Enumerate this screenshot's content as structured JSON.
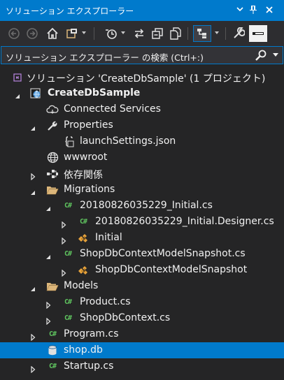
{
  "window": {
    "title": "ソリューション エクスプローラー",
    "buttons": [
      "chevron-down-icon",
      "pin-icon",
      "close-icon"
    ]
  },
  "toolbar": {
    "icons": [
      "back-icon",
      "forward-icon",
      "home-icon",
      "switch-views-icon",
      "pending-changes-filter-icon",
      "sync-icon",
      "collapse-all-icon",
      "show-all-files-icon",
      "properties-icon",
      "preview-icon"
    ]
  },
  "search": {
    "placeholder": "ソリューション エクスプローラー の検索 (Ctrl+:)"
  },
  "tree": [
    {
      "label": "ソリューション 'CreateDbSample' (1 プロジェクト)",
      "icon": "solution-icon",
      "expander": "none",
      "bold": false
    },
    {
      "label": "CreateDbSample",
      "icon": "web-project-icon",
      "expander": "expanded",
      "bold": true
    },
    {
      "label": "Connected Services",
      "icon": "connected-services-icon",
      "expander": "none",
      "bold": false
    },
    {
      "label": "Properties",
      "icon": "wrench-icon",
      "expander": "expanded",
      "bold": false
    },
    {
      "label": "launchSettings.json",
      "icon": "json-file-icon",
      "expander": "none",
      "bold": false
    },
    {
      "label": "wwwroot",
      "icon": "globe-icon",
      "expander": "none",
      "bold": false
    },
    {
      "label": "依存関係",
      "icon": "dependencies-icon",
      "expander": "collapsed",
      "bold": false
    },
    {
      "label": "Migrations",
      "icon": "folder-open-icon",
      "expander": "expanded",
      "bold": false
    },
    {
      "label": "20180826035229_Initial.cs",
      "icon": "csharp-file-icon",
      "expander": "expanded",
      "bold": false
    },
    {
      "label": "20180826035229_Initial.Designer.cs",
      "icon": "csharp-file-icon",
      "expander": "collapsed",
      "bold": false
    },
    {
      "label": "Initial",
      "icon": "class-icon",
      "expander": "collapsed",
      "bold": false
    },
    {
      "label": "ShopDbContextModelSnapshot.cs",
      "icon": "csharp-file-icon",
      "expander": "expanded",
      "bold": false
    },
    {
      "label": "ShopDbContextModelSnapshot",
      "icon": "class-icon",
      "expander": "collapsed",
      "bold": false
    },
    {
      "label": "Models",
      "icon": "folder-open-icon",
      "expander": "expanded",
      "bold": false
    },
    {
      "label": "Product.cs",
      "icon": "csharp-file-icon",
      "expander": "collapsed",
      "bold": false
    },
    {
      "label": "ShopDbContext.cs",
      "icon": "csharp-file-icon",
      "expander": "collapsed",
      "bold": false
    },
    {
      "label": "Program.cs",
      "icon": "csharp-file-icon",
      "expander": "collapsed",
      "bold": false
    },
    {
      "label": "shop.db",
      "icon": "database-icon",
      "expander": "none",
      "bold": false,
      "selected": true
    },
    {
      "label": "Startup.cs",
      "icon": "csharp-file-icon",
      "expander": "collapsed",
      "bold": false
    }
  ],
  "colors": {
    "accent": "#007acc",
    "background": "#252526",
    "toolbar": "#2d2d30",
    "text": "#f1f1f1",
    "csharp": "#5fc45f",
    "folder": "#dcb67a"
  }
}
